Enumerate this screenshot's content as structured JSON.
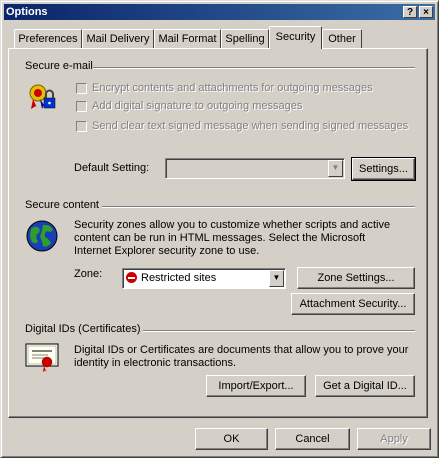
{
  "window": {
    "title": "Options",
    "help_glyph": "?",
    "close_glyph": "×"
  },
  "tabs": [
    {
      "label": "Preferences"
    },
    {
      "label": "Mail Delivery"
    },
    {
      "label": "Mail Format"
    },
    {
      "label": "Spelling"
    },
    {
      "label": "Security"
    },
    {
      "label": "Other"
    }
  ],
  "active_tab": "Security",
  "secure_email": {
    "heading": "Secure e-mail",
    "options": [
      {
        "label": "Encrypt contents and attachments for outgoing messages",
        "checked": false,
        "enabled": false
      },
      {
        "label": "Add digital signature to outgoing messages",
        "checked": false,
        "enabled": false
      },
      {
        "label": "Send clear text signed message when sending signed messages",
        "checked": false,
        "enabled": false
      }
    ],
    "default_setting_label": "Default Setting:",
    "default_setting_value": "",
    "settings_button": "Settings..."
  },
  "secure_content": {
    "heading": "Secure content",
    "description": "Security zones allow you to customize whether scripts and active content can be run in HTML messages.  Select the Microsoft Internet Explorer security zone to use.",
    "zone_label": "Zone:",
    "zone_value": "Restricted sites",
    "zone_settings_button": "Zone Settings...",
    "attachment_security_button": "Attachment Security..."
  },
  "digital_ids": {
    "heading": "Digital IDs (Certificates)",
    "description": "Digital IDs or Certificates are documents that allow you to prove your identity in electronic transactions.",
    "import_export_button": "Import/Export...",
    "get_id_button": "Get a Digital ID..."
  },
  "footer": {
    "ok": "OK",
    "cancel": "Cancel",
    "apply": "Apply"
  },
  "colors": {
    "face": "#d4d0c8",
    "title_start": "#0a246a",
    "title_end": "#3a6ea5",
    "restricted_red": "#cc0000"
  }
}
